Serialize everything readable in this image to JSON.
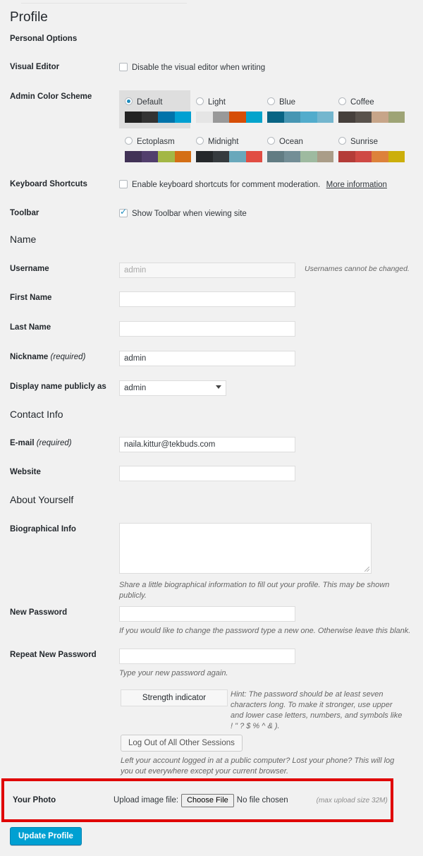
{
  "page": {
    "title": "Profile",
    "update_button": "Update Profile"
  },
  "personal_options": {
    "heading": "Personal Options",
    "visual_editor": {
      "label": "Visual Editor",
      "checkbox_label": "Disable the visual editor when writing",
      "checked": false
    },
    "admin_color_scheme": {
      "label": "Admin Color Scheme",
      "selected": "Default",
      "schemes": [
        {
          "name": "Default",
          "selected": true,
          "colors": [
            "#222222",
            "#333333",
            "#0073aa",
            "#00a0d2"
          ]
        },
        {
          "name": "Light",
          "selected": false,
          "colors": [
            "#e5e5e5",
            "#999999",
            "#d64e07",
            "#04a4cc"
          ]
        },
        {
          "name": "Blue",
          "selected": false,
          "colors": [
            "#096484",
            "#4796b3",
            "#52accc",
            "#74b6ce"
          ]
        },
        {
          "name": "Coffee",
          "selected": false,
          "colors": [
            "#46403c",
            "#59524c",
            "#c7a589",
            "#9ea476"
          ]
        },
        {
          "name": "Ectoplasm",
          "selected": false,
          "colors": [
            "#413256",
            "#523f6d",
            "#a3b745",
            "#d46f15"
          ]
        },
        {
          "name": "Midnight",
          "selected": false,
          "colors": [
            "#25282b",
            "#363b3f",
            "#69a8bb",
            "#e14d43"
          ]
        },
        {
          "name": "Ocean",
          "selected": false,
          "colors": [
            "#627c83",
            "#738e96",
            "#9ebaa0",
            "#aa9d88"
          ]
        },
        {
          "name": "Sunrise",
          "selected": false,
          "colors": [
            "#b43c38",
            "#cf4944",
            "#dd823b",
            "#ccaf0b"
          ]
        }
      ]
    },
    "keyboard_shortcuts": {
      "label": "Keyboard Shortcuts",
      "checkbox_label": "Enable keyboard shortcuts for comment moderation.",
      "link_label": "More information",
      "checked": false
    },
    "toolbar": {
      "label": "Toolbar",
      "checkbox_label": "Show Toolbar when viewing site",
      "checked": true
    }
  },
  "name_section": {
    "heading": "Name",
    "username": {
      "label": "Username",
      "value": "admin",
      "note": "Usernames cannot be changed."
    },
    "first_name": {
      "label": "First Name",
      "value": ""
    },
    "last_name": {
      "label": "Last Name",
      "value": ""
    },
    "nickname": {
      "label": "Nickname",
      "required": "(required)",
      "value": "admin"
    },
    "display_name": {
      "label": "Display name publicly as",
      "value": "admin",
      "options": [
        "admin"
      ]
    }
  },
  "contact_info": {
    "heading": "Contact Info",
    "email": {
      "label": "E-mail",
      "required": "(required)",
      "value": "naila.kittur@tekbuds.com"
    },
    "website": {
      "label": "Website",
      "value": ""
    }
  },
  "about_yourself": {
    "heading": "About Yourself",
    "biographical_info": {
      "label": "Biographical Info",
      "value": "",
      "hint": "Share a little biographical information to fill out your profile. This may be shown publicly."
    },
    "new_password": {
      "label": "New Password",
      "value": "",
      "hint": "If you would like to change the password type a new one. Otherwise leave this blank."
    },
    "repeat_password": {
      "label": "Repeat New Password",
      "value": "",
      "hint": "Type your new password again."
    },
    "strength_indicator": {
      "label": "Strength indicator",
      "hint": "Hint: The password should be at least seven characters long. To make it stronger, use upper and lower case letters, numbers, and symbols like ! \" ? $ % ^ & )."
    },
    "sessions": {
      "button_label": "Log Out of All Other Sessions",
      "hint": "Left your account logged in at a public computer? Lost your phone? This will log you out everywhere except your current browser."
    }
  },
  "your_photo": {
    "label": "Your Photo",
    "upload_label": "Upload image file:",
    "choose_file_label": "Choose File",
    "no_file_label": "No file chosen",
    "max_size_label": "(max upload size 32M)",
    "highlight_color": "#e00000"
  }
}
